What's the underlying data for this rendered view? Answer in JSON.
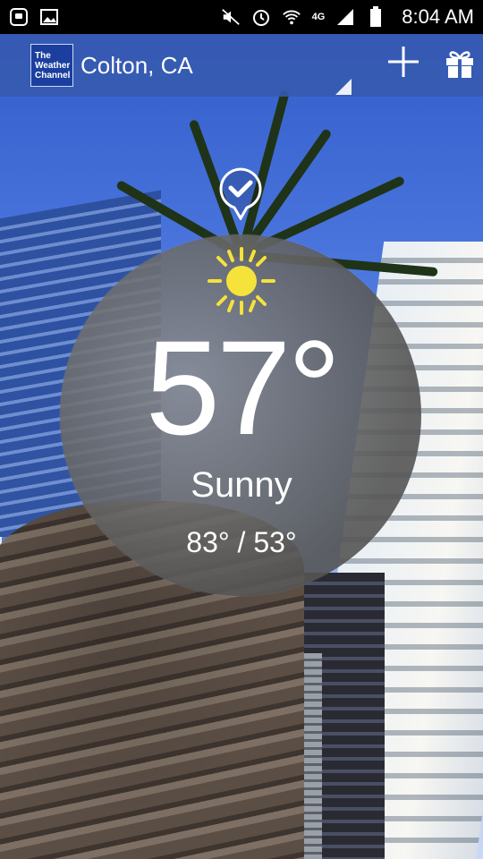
{
  "status_bar": {
    "time": "8:04 AM",
    "network": "4G",
    "left_icons": [
      "notification-app-icon",
      "image-icon"
    ],
    "right_icons": [
      "mute-icon",
      "alarm-icon",
      "wifi-icon",
      "signal-icon",
      "battery-icon"
    ]
  },
  "app_bar": {
    "logo_lines": [
      "The",
      "Weather",
      "Channel"
    ],
    "location": "Colton, CA",
    "actions": [
      "add-location",
      "gift"
    ]
  },
  "weather": {
    "temperature": "57°",
    "condition": "Sunny",
    "high_low": "83° / 53°"
  },
  "colors": {
    "app_bar": "#375aaf",
    "sun": "#f5e23a",
    "circle": "#6e6e6e"
  }
}
